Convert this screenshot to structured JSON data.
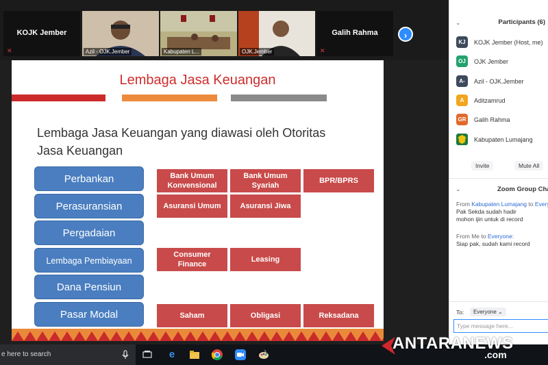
{
  "gallery": {
    "tiles": [
      {
        "label": "KOJK Jember",
        "type": "name"
      },
      {
        "label": "Azil - OJK.Jember",
        "type": "video"
      },
      {
        "label": "Kabupaten L...",
        "type": "video"
      },
      {
        "label": "OJK.Jember",
        "type": "video"
      },
      {
        "label": "Galih Rahma",
        "type": "name"
      }
    ],
    "next_icon": "›"
  },
  "slide": {
    "title": "Lembaga Jasa Keuangan",
    "bar_colors": [
      "#cc2a2a",
      "#ee8a3b",
      "#8a8a8a"
    ],
    "lead": "Lembaga Jasa Keuangan yang diawasi oleh Otoritas Jasa Keuangan",
    "categories": [
      "Perbankan",
      "Perasuransian",
      "Pergadaian",
      "Lembaga Pembiayaan",
      "Dana Pensiun",
      "Pasar Modal"
    ],
    "items": [
      [
        "Bank Umum Konvensional",
        "Bank Umum Syariah",
        "BPR/BPRS"
      ],
      [
        "Asuransi Umum",
        "Asuransi Jiwa"
      ],
      [],
      [
        "Consumer Finance",
        "Leasing"
      ],
      [],
      [
        "Saham",
        "Obligasi",
        "Reksadana"
      ]
    ]
  },
  "panel": {
    "participants_title": "Participants (6)",
    "participants": [
      {
        "initials": "KJ",
        "name": "KOJK Jember (Host, me)",
        "color": "#3d4a5c"
      },
      {
        "initials": "OJ",
        "name": "OJK Jember",
        "color": "#24a16d"
      },
      {
        "initials": "A-",
        "name": "Azil - OJK.Jember",
        "color": "#3d4a5c"
      },
      {
        "initials": "A",
        "name": "Aditzamrud",
        "color": "#f2a51f"
      },
      {
        "initials": "GR",
        "name": "Galih Rahma",
        "color": "#e06a2b"
      },
      {
        "initials": "",
        "name": "Kabupaten Lumajang",
        "color": "#1f7a3e"
      }
    ],
    "invite_label": "Invite",
    "mute_all_label": "Mute All",
    "chat_title": "Zoom Group Chat",
    "messages": [
      {
        "from_prefix": "From ",
        "sender": "Kabupaten Lumajang",
        "to_prefix": " to ",
        "recipient": "Everyone",
        "lines": [
          "Pak Sekda sudah hadir",
          "mohon ijin untuk di record"
        ]
      },
      {
        "from_prefix": "From Me to ",
        "sender": "",
        "to_prefix": "",
        "recipient": "Everyone:",
        "lines": [
          "Siap pak, sudah kami record"
        ]
      }
    ],
    "to_label": "To:",
    "to_value": "Everyone",
    "input_placeholder": "Type message here..."
  },
  "taskbar": {
    "search_text": "e here to search",
    "icons": [
      "microphone-icon",
      "task-view-icon",
      "edge-icon",
      "file-explorer-icon",
      "chrome-icon",
      "zoom-icon",
      "paint-icon"
    ]
  },
  "watermark": {
    "text": "ANTARANEWS",
    "suffix": ".com"
  }
}
